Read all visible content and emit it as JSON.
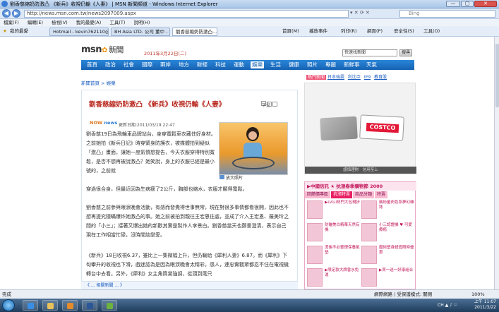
{
  "window": {
    "title": "劉香慈縮奶防激凸 《新兵》收視仍輸《人妻》 | MSN 新聞頻道 - Windows Internet Explorer",
    "min": "—",
    "max": "▢",
    "close": "✕"
  },
  "browser": {
    "back": "◀",
    "forward": "▶",
    "url": "http://news.msn.com.tw/news2097009.aspx",
    "url_icons": "▾ ✕ ⟳ ✕",
    "search_placeholder": "Bing",
    "menu": [
      "檔案(F)",
      "編輯(E)",
      "檢視(V)",
      "我的最愛(A)",
      "工具(T)",
      "說明(H)"
    ],
    "favorites_label": "我的最愛",
    "tabs": [
      {
        "label": "Hotmail - kevin762110@...",
        "active": false
      },
      {
        "label": "BH Asia LTD. 公司 董中 - ...",
        "active": false
      },
      {
        "label": "劉香慈縮奶防激凸...",
        "active": true
      }
    ],
    "commands": [
      "首頁(M)",
      "播放事件",
      "列印(R)",
      "網頁(P)",
      "安全性(S)",
      "工具(O)"
    ]
  },
  "header": {
    "logo": "msn",
    "section": "新聞",
    "date": "2011年3月22日(二)",
    "search_value": "快速找新聞",
    "search_button": "搜尋"
  },
  "nav": {
    "items": [
      "首頁",
      "政治",
      "社會",
      "國際",
      "兩岸",
      "地方",
      "財經",
      "科技",
      "運動",
      "娛樂",
      "生活",
      "健康",
      "照片",
      "專題",
      "新鮮事",
      "天氣"
    ],
    "selected": "娛樂"
  },
  "subnav": {
    "hot": "熱門新聞",
    "links": [
      "日本強震",
      "利比亞",
      "IE9",
      "教育股"
    ]
  },
  "breadcrumb": "新聞首頁 > 娛樂",
  "article": {
    "headline": "劉香慈縮奶防激凸 《新兵》收視仍輸《人妻》",
    "font_label": "字型",
    "source_logo": "NOW",
    "source_logo_sub": "news",
    "updated": "更新日期:2011/03/19 22:47",
    "photo_caption": "放大照片",
    "p1": "劉香慈19日為飛輪車品牌站台，身穿寬鬆車衣藏住好身材。之前她拍《新兵日記》時穿緊身防護衣，被媒體拍到疑似「激凸」畫面，讓她一度氣憤想提告，今天衣服穿得特別寬鬆，是否不想再被說激凸？她笑說，身上的衣服已經是最小號的，之前就",
    "p1b": "穿過很合身，但最近因為生病瘦了2公斤，胸部也縮水，衣服才顯得寬鬆。",
    "p2": "劉香慈之前參與眼淚晚會活動，有感而發覺得世事無常，現在對很多事情都看很開，因此也不想再提究隱瞞爆炸她激凸的事。她之前被拍到親往王宏恩往處，並成了介入王宏恩、羅美玲之間的「小三」；接著又爆出她的新歡其實是製作人李景白。劉香慈當天也鄭重澄清，表示自己現在工作相當忙碌，沒時間談戀愛。",
    "p3": "《新兵》18日收視6.37，雖比上一集微幅上升，但仍輸給《犀利人妻》6.87。而《犀利》下旬攀升的收視也下滑，戲迷認為是因為眼淚晚會太精彩，感人，連忠實觀眾都忍不住在電視機轉台中去看。另外，《犀利》女主角隋棠強調，從頭到尾只"
  },
  "ads": {
    "top_caption": "謹慎理財　信用至上",
    "costco": "COSTCO",
    "mall_title": "▶中國信託 ★ 抗漲春季購物節 2000",
    "mall_tabs": [
      "回饋價專區",
      "抗漲特賣",
      "商品分類",
      "特賣"
    ],
    "products": [
      "▶LV\\LI熱門大包現折",
      "繽紛量肉色系夢幻雜誌",
      "防曬美白精華天然有機",
      "小三認證機 ♥ 可愛療癒",
      "燙後不必整理保養氣墊",
      "魔術塑身超值限時優惠",
      "▶限定款大牌香水免運",
      "▶買一送一好康組合"
    ]
  },
  "footer_strip": "《 ... 相關新聞 ... 》",
  "status": {
    "left": "完成",
    "zone": "網際網路 | 受保護模式: 關閉",
    "zoom": "100%"
  },
  "taskbar": {
    "time": "上午 11:07",
    "date": "2011/3/22",
    "tray": "CH ▲ ♪ ⚐"
  },
  "colors": {
    "nav_blue": "#1662b4",
    "headline_red": "#b8281f",
    "costco_red": "#e31837",
    "ad_pink": "#e91e63"
  }
}
